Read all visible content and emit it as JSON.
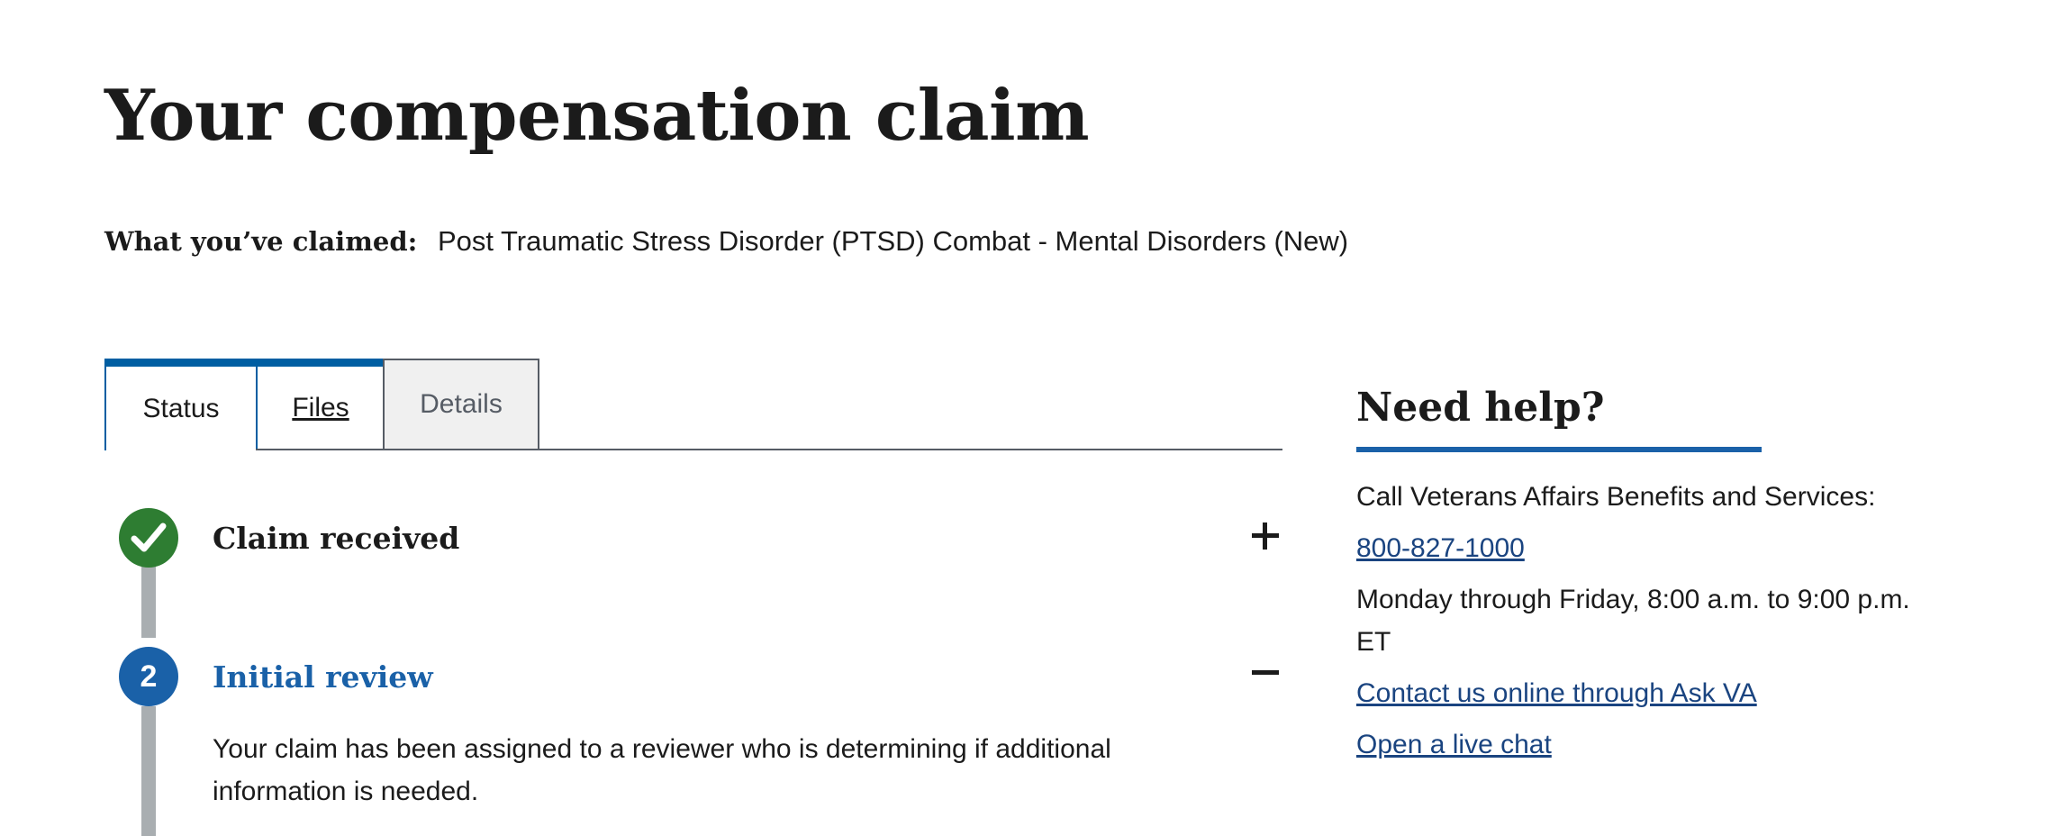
{
  "header": {
    "title": "Your compensation claim",
    "claimed_label": "What you’ve claimed:",
    "claimed_value": "Post Traumatic Stress Disorder (PTSD) Combat - Mental Disorders (New)"
  },
  "tabs": [
    {
      "label": "Status",
      "active": true
    },
    {
      "label": "Files",
      "active": false
    },
    {
      "label": "Details",
      "active": false
    }
  ],
  "timeline": {
    "steps": [
      {
        "marker": "✔",
        "title": "Claim received",
        "state": "complete",
        "toggle": "plus-icon"
      },
      {
        "marker": "2",
        "title": "Initial review",
        "state": "current",
        "toggle": "minus-icon",
        "description": "Your claim has been assigned to a reviewer who is determining if additional information is needed."
      }
    ]
  },
  "help": {
    "title": "Need help?",
    "call_text": "Call Veterans Affairs Benefits and Services:",
    "phone": "800-827-1000",
    "hours": "Monday through Friday, 8:00 a.m. to 9:00 p.m. ET",
    "contact_link": "Contact us online through Ask VA",
    "chat_link": "Open a live chat"
  },
  "colors": {
    "accent": "#1a61a8",
    "complete": "#2e7d32",
    "link": "#1a4480",
    "rail": "#a9aeb1"
  }
}
